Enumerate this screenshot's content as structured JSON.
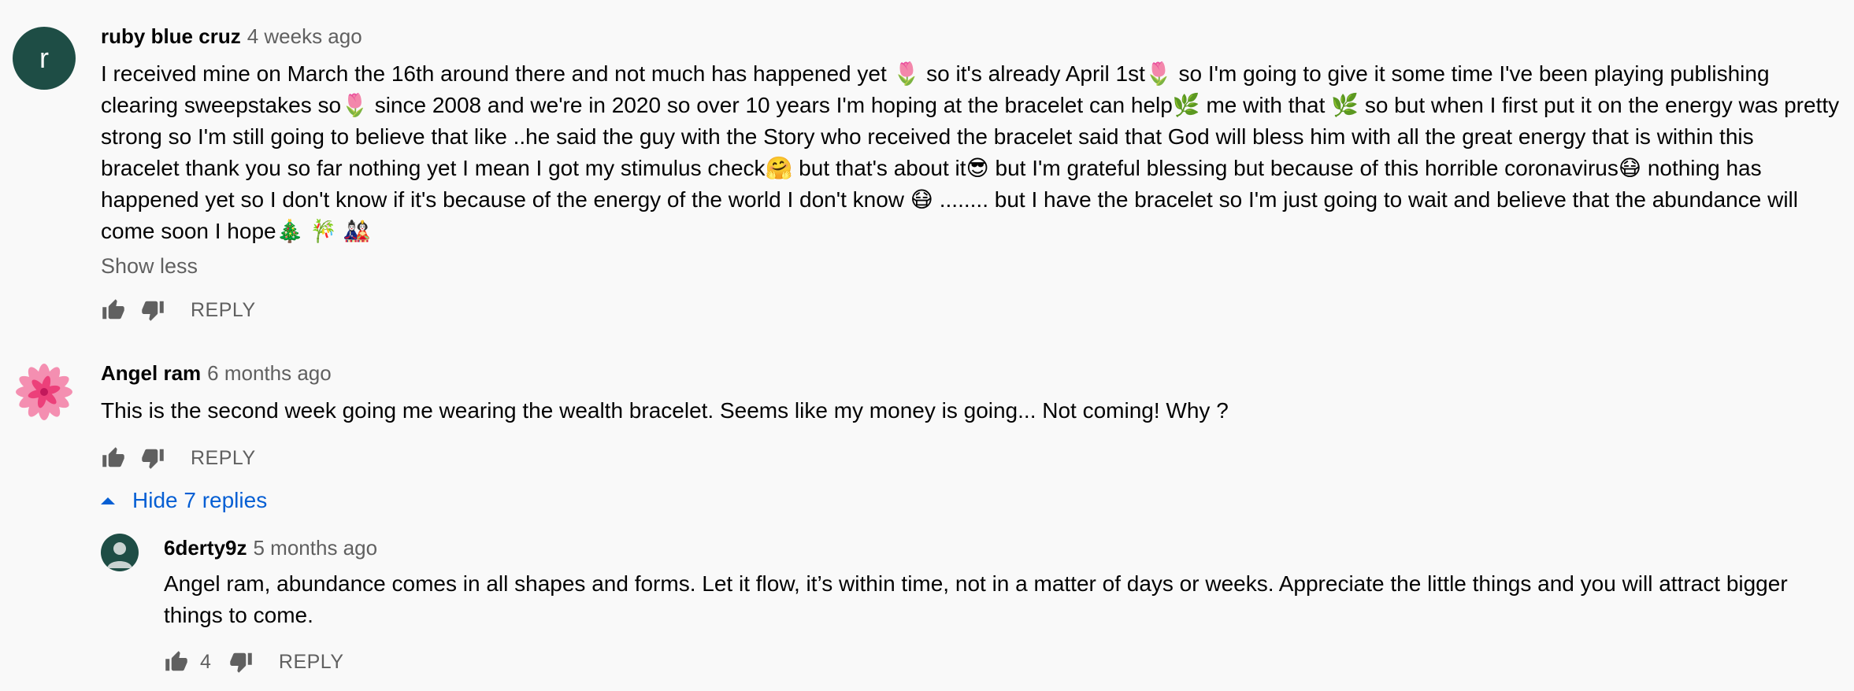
{
  "comments": [
    {
      "avatar_letter": "r",
      "avatar_color": "#1e4d45",
      "author": "ruby blue cruz",
      "time": "4 weeks ago",
      "body_lines": [
        "I received mine on March the 16th around there and not much has happened yet 🌷 so it's already April 1st🌷  so I'm going to give it some time I've been playing publishing",
        "clearing sweepstakes so🌷  since 2008 and we're in 2020 so over 10 years I'm hoping at the bracelet  can help🌿  me with that 🌿 so but when I first put it on the energy was pretty",
        "strong so I'm still going to believe that like ..he said the guy with the  Story who received the bracelet said that God will bless him with all the great energy that is within this",
        "bracelet thank you so far nothing yet I mean I got my stimulus check🤗  but that's about it😎  but I'm grateful blessing but because of this horrible coronavirus😷   nothing has",
        "happened yet so I don't know if it's because of the energy of the world I don't know 😷 ........ but I have the bracelet so I'm just going to wait and believe that the abundance will",
        "come soon I hope🎄 🎋 🎎"
      ],
      "show_less": "Show less",
      "reply_label": "REPLY"
    },
    {
      "author": "Angel ram",
      "time": "6 months ago",
      "body_lines": [
        "This is the second week going me wearing the wealth bracelet. Seems like my money is going... Not coming! Why ?"
      ],
      "reply_label": "REPLY",
      "hide_replies": "Hide 7 replies"
    }
  ],
  "replies": [
    {
      "author": "6derty9z",
      "time": "5 months ago",
      "avatar_color": "#1e4d45",
      "body_lines": [
        "Angel ram,  abundance comes in all shapes and forms. Let it flow, it’s within time, not in a matter of days or weeks. Appreciate the little things and you will attract bigger",
        "things to come."
      ],
      "likes": "4",
      "reply_label": "REPLY"
    }
  ],
  "icons": {
    "like": "thumb-up-icon",
    "dislike": "thumb-down-icon",
    "caret": "caret-up-icon",
    "flower_avatar": "pink-flower-avatar"
  },
  "colors": {
    "link_blue": "#065fd4",
    "meta_gray": "#606060",
    "background": "#f9f9f9"
  }
}
